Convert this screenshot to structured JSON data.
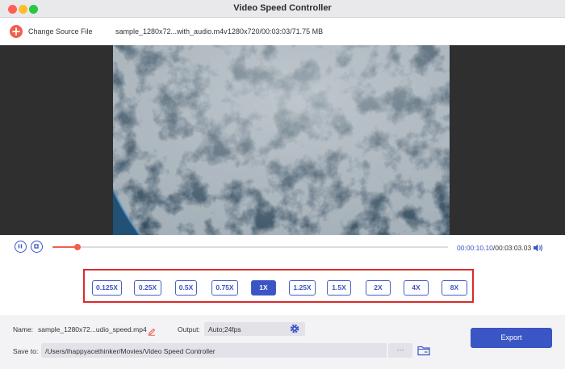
{
  "window": {
    "title": "Video Speed Controller"
  },
  "topbar": {
    "change_source_label": "Change Source File",
    "file_name": "sample_1280x72...with_audio.m4v",
    "file_meta": "1280x720/00:03:03/71.75 MB"
  },
  "player": {
    "current_time": "00:00:10.10",
    "total_time": "/00:03:03.03",
    "progress_fraction": 0.063
  },
  "speeds": [
    {
      "label": "0.125X",
      "active": false
    },
    {
      "label": "0.25X",
      "active": false
    },
    {
      "label": "0.5X",
      "active": false
    },
    {
      "label": "0.75X",
      "active": false
    },
    {
      "label": "1X",
      "active": true
    },
    {
      "label": "1.25X",
      "active": false
    },
    {
      "label": "1.5X",
      "active": false
    },
    {
      "label": "2X",
      "active": false
    },
    {
      "label": "4X",
      "active": false
    },
    {
      "label": "8X",
      "active": false
    }
  ],
  "output": {
    "name_label": "Name:",
    "name_value": "sample_1280x72...udio_speed.mp4",
    "output_label": "Output:",
    "output_value": "Auto;24fps",
    "save_label": "Save to:",
    "save_path": "/Users/ihappyacethinker/Movies/Video Speed Controller",
    "more_label": "···",
    "export_label": "Export"
  },
  "colors": {
    "accent": "#3a55c4",
    "orange": "#f0604c",
    "highlight": "#d92b2b"
  }
}
